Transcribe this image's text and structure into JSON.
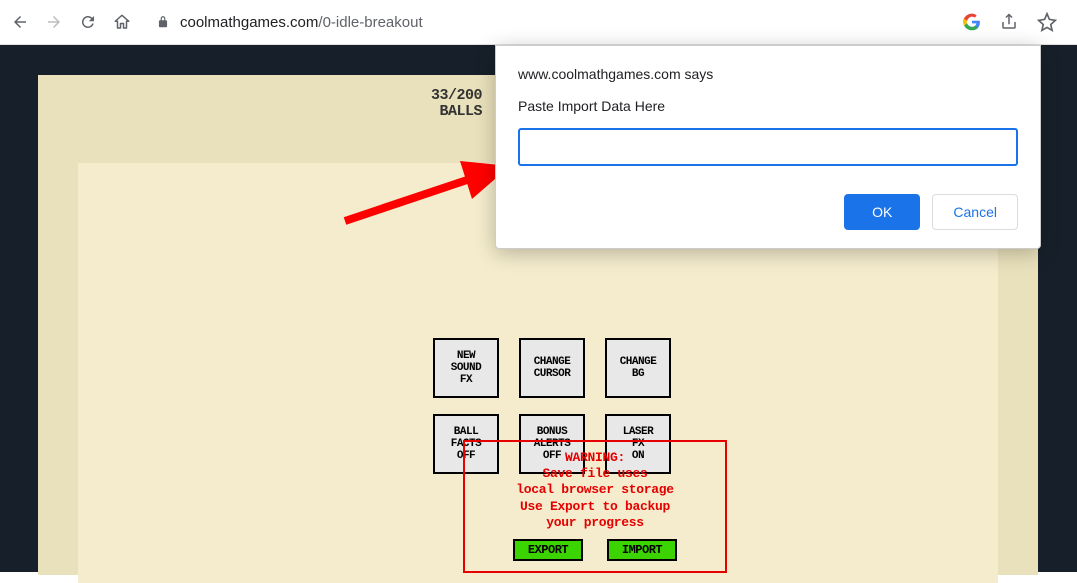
{
  "browser": {
    "url_host": "coolmathgames.com",
    "url_path": "/0-idle-breakout"
  },
  "game": {
    "stat_line1": "33/200",
    "stat_line2": "BALLS",
    "buttons": [
      {
        "l1": "NEW",
        "l2": "SOUND",
        "l3": "FX"
      },
      {
        "l1": "CHANGE",
        "l2": "CURSOR",
        "l3": ""
      },
      {
        "l1": "CHANGE",
        "l2": "BG",
        "l3": ""
      },
      {
        "l1": "BALL",
        "l2": "FACTS",
        "l3": "OFF"
      },
      {
        "l1": "BONUS",
        "l2": "ALERTS",
        "l3": "OFF"
      },
      {
        "l1": "LASER",
        "l2": "FX",
        "l3": "ON"
      }
    ],
    "warning": {
      "l1": "WARNING:",
      "l2": "Save file uses",
      "l3": "local browser storage",
      "l4": "Use Export to backup",
      "l5": "your progress"
    },
    "export_label": "EXPORT",
    "import_label": "IMPORT"
  },
  "dialog": {
    "title": "www.coolmathgames.com says",
    "subtitle": "Paste Import Data Here",
    "input_value": "",
    "ok_label": "OK",
    "cancel_label": "Cancel"
  }
}
